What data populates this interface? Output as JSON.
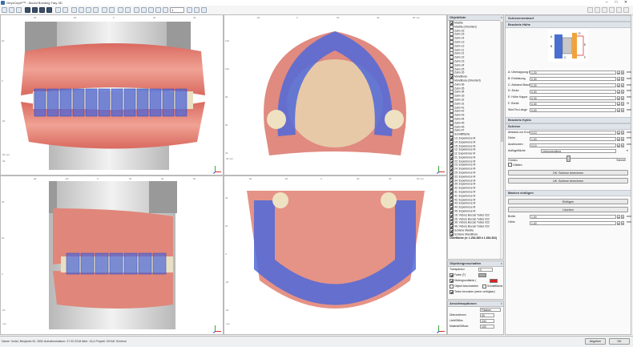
{
  "window": {
    "title": "OnyxCeph³™ - Modul Bonding Tray 3D",
    "minimize": "–",
    "maximize": "□",
    "close": "✕"
  },
  "toolbar": {
    "zoom_value": "1"
  },
  "viewports": {
    "top_left": {
      "ticks_x": [
        "-40",
        "-20",
        "0",
        "20",
        "40"
      ],
      "ticks_y": [
        "20",
        "0",
        "-20",
        "-40"
      ],
      "unit": "60 mm"
    },
    "top_right": {
      "ticks_x": [
        "-20",
        "0",
        "20",
        "40",
        "60 mm"
      ],
      "ticks_y": [
        "120",
        "100",
        "80",
        "60",
        "40"
      ],
      "unit": "40 mm"
    },
    "bottom_left": {
      "ticks_x": [
        "-40",
        "-20",
        "0",
        "20",
        "40",
        "60"
      ],
      "ticks_y": [
        "40",
        "20",
        "0",
        "-20"
      ],
      "unit": "mm"
    },
    "bottom_right": {
      "ticks_x": [
        "-40",
        "-20",
        "0",
        "20",
        "40",
        "60 mm"
      ],
      "ticks_y": [
        "40",
        "20",
        "0",
        "-20",
        "-40"
      ],
      "unit": "mm"
    }
  },
  "objects": {
    "header": "Objektliste",
    "items": [
      {
        "label": "Maxilla",
        "checked": true
      },
      {
        "label": "Maxilla (Orientiert)",
        "checked": false
      },
      {
        "label": "Zahn 16",
        "checked": false
      },
      {
        "label": "Zahn 15",
        "checked": false
      },
      {
        "label": "Zahn 14",
        "checked": false
      },
      {
        "label": "Zahn 13",
        "checked": false
      },
      {
        "label": "Zahn 12",
        "checked": false
      },
      {
        "label": "Zahn 11",
        "checked": false
      },
      {
        "label": "Zahn 21",
        "checked": false
      },
      {
        "label": "Zahn 22",
        "checked": false
      },
      {
        "label": "Zahn 23",
        "checked": false
      },
      {
        "label": "Zahn 24",
        "checked": false
      },
      {
        "label": "Zahn 25",
        "checked": false
      },
      {
        "label": "Zahn 26",
        "checked": false
      },
      {
        "label": "Mandibula",
        "checked": true
      },
      {
        "label": "Mandibula (Orientiert)",
        "checked": false
      },
      {
        "label": "Zahn 36",
        "checked": false
      },
      {
        "label": "Zahn 35",
        "checked": false
      },
      {
        "label": "Zahn 34",
        "checked": false
      },
      {
        "label": "Zahn 33",
        "checked": false
      },
      {
        "label": "Zahn 32",
        "checked": false
      },
      {
        "label": "Zahn 31",
        "checked": false
      },
      {
        "label": "Zahn 41",
        "checked": false
      },
      {
        "label": "Zahn 42",
        "checked": false
      },
      {
        "label": "Zahn 43",
        "checked": false
      },
      {
        "label": "Zahn 44",
        "checked": false
      },
      {
        "label": "Zahn 45",
        "checked": false
      },
      {
        "label": "Zahn 46",
        "checked": false
      },
      {
        "label": "Zahn 47",
        "checked": false
      },
      {
        "label": "Schnittfläche",
        "checked": false
      },
      {
        "label": "13: Experience M",
        "checked": true
      },
      {
        "label": "14: Experience M",
        "checked": true
      },
      {
        "label": "15: Experience M",
        "checked": true
      },
      {
        "label": "12: Experience M",
        "checked": true
      },
      {
        "label": "11: Experience M",
        "checked": true
      },
      {
        "label": "21: Experience M",
        "checked": true
      },
      {
        "label": "22: Experience M",
        "checked": true
      },
      {
        "label": "23: Experience M",
        "checked": true
      },
      {
        "label": "24: Experience M",
        "checked": true
      },
      {
        "label": "25: Experience M",
        "checked": true
      },
      {
        "label": "33: Experience M",
        "checked": true
      },
      {
        "label": "34: Experience M",
        "checked": true
      },
      {
        "label": "35: Experience M",
        "checked": true
      },
      {
        "label": "32: Experience M",
        "checked": true
      },
      {
        "label": "31: Experience M",
        "checked": true
      },
      {
        "label": "41: Experience M",
        "checked": true
      },
      {
        "label": "42: Experience M",
        "checked": true
      },
      {
        "label": "43: Experience M",
        "checked": true
      },
      {
        "label": "44: Experience M",
        "checked": true
      },
      {
        "label": "45: Experience M",
        "checked": true
      },
      {
        "label": "16: Victory Buccal Tubes 022",
        "checked": true
      },
      {
        "label": "26: Victory Buccal Tubes 022",
        "checked": true
      },
      {
        "label": "36: Victory Buccal Tubes 022",
        "checked": true
      },
      {
        "label": "46: Victory Buccal Tubes 022",
        "checked": true
      },
      {
        "label": "Schiene Maxilla",
        "checked": true
      },
      {
        "label": "Schiene Mandibula",
        "checked": true
      }
    ],
    "footer": "Oberfläche (n: 1.254.285 k 1.354.302)"
  },
  "properties": {
    "header": "Objekteigenschaften",
    "transparency_label": "Transparenz",
    "transparency_value": "0",
    "color_label": "Farbe (T)",
    "color_value": "#a9a9a9",
    "bg_label": "Hintergrundfarbe (",
    "bg_value": "#e02020",
    "obj_label": "Objekt beschneiden",
    "obj2_label": "Schnittfläche",
    "texture_label": "Textur benutzen (wenn verfügbar)"
  },
  "view_options": {
    "header": "Ansichtsoptionen",
    "mode_value": "Flächen",
    "rows": [
      {
        "label": "Überzeichnen",
        "value": "30"
      },
      {
        "label": "Licht/Diffus",
        "value": "240"
      },
      {
        "label": "Material/Diffuse",
        "value": "100"
      }
    ]
  },
  "panel": {
    "top_header": "Schienenentwurf",
    "bracket_height_header": "Brackets Höhe",
    "fields": [
      {
        "label": "A: Überlappung Bukk",
        "value": "1,20",
        "unit": "mm"
      },
      {
        "label": "B: Einfräsung",
        "value": "0,30",
        "unit": "mm"
      },
      {
        "label": "C: Abstand Bracket",
        "value": "0,30",
        "unit": "mm"
      },
      {
        "label": "D: Dicke",
        "value": "0,30",
        "unit": "mm"
      },
      {
        "label": "E: Höhe Kappe",
        "value": "0,30",
        "unit": "mm"
      },
      {
        "label": "F: Breite",
        "value": "0,30",
        "unit": "%"
      },
      {
        "label": "Skin/Tor-Länge",
        "value": "0,00",
        "unit": "mm"
      }
    ],
    "brackets_type_header": "Brackets Kyklo",
    "schiene_header": "Schiene",
    "schiene_fields": [
      {
        "label": "Abstand zur Krone",
        "value": "0,10",
        "unit": "mm"
      },
      {
        "label": "Dicke",
        "value": "1,00",
        "unit": "mm"
      },
      {
        "label": "Ausblocken",
        "value": "0,10",
        "unit": "mm"
      }
    ],
    "surface_label": "Auflagefläche",
    "surface_value": "Umkurvendiera",
    "slider_left": "Grossu",
    "slider_right": "Schnell",
    "glatten_label": "Glätten",
    "oben_button": "OK: Schiene berechnen",
    "unten_button": "UK: Schiene berechnen",
    "marks_header": "Marken einfügen",
    "insert_button": "Einfügen",
    "delete_button": "Löschen",
    "mark_fields": [
      {
        "label": "Breite",
        "value": "1,00",
        "unit": "mm"
      },
      {
        "label": "Höhe",
        "value": "1,00",
        "unit": "mm"
      }
    ],
    "diagram_labels": [
      "A",
      "B",
      "C",
      "D",
      "E",
      "F"
    ]
  },
  "status": {
    "text": "Name: Vorlst, Benjamin   ID: 2652   Aufnahmedatum: 27.02.2018   Alter: 16,4   Projekt: OK/UK Schiene",
    "done_button": "Abgeben",
    "ok_button": "OK"
  }
}
